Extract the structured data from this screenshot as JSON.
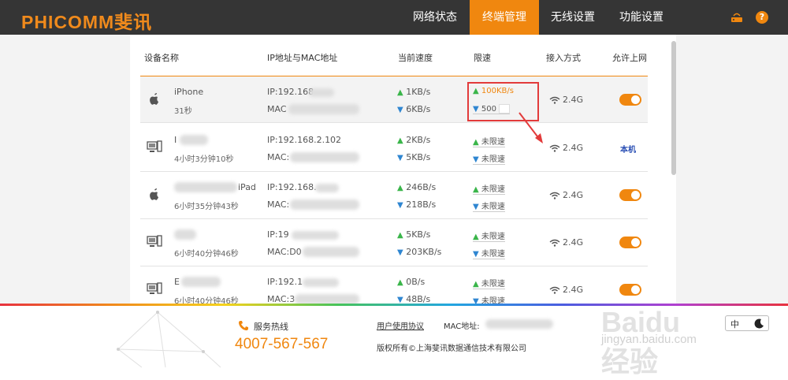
{
  "brand": {
    "logo": "PHICOMM斐讯"
  },
  "nav": [
    {
      "label": "网络状态",
      "active": false
    },
    {
      "label": "终端管理",
      "active": true
    },
    {
      "label": "无线设置",
      "active": false
    },
    {
      "label": "功能设置",
      "active": false
    }
  ],
  "help_label": "?",
  "table": {
    "headers": [
      "设备名称",
      "IP地址与MAC地址",
      "当前速度",
      "限速",
      "接入方式",
      "允许上网"
    ],
    "rows": [
      {
        "icon": "apple-icon",
        "name": "iPhone",
        "time": "31秒",
        "ip": "IP:192.168",
        "mac": "MAC",
        "up": "1KB/s",
        "down": "6KB/s",
        "limit_up": "100KB/s",
        "limit_down": "500",
        "access": "2.4G",
        "allow": "toggle-on"
      },
      {
        "icon": "pc-icon",
        "name": "I",
        "time": "4小时3分钟10秒",
        "ip": "IP:192.168.2.102",
        "mac": "MAC:",
        "up": "2KB/s",
        "down": "5KB/s",
        "limit_up": "未限速",
        "limit_down": "未限速",
        "access": "2.4G",
        "allow": "本机"
      },
      {
        "icon": "apple-icon",
        "name": "iPad",
        "time": "6小时35分钟43秒",
        "ip": "IP:192.168.",
        "mac": "MAC:",
        "up": "246B/s",
        "down": "218B/s",
        "limit_up": "未限速",
        "limit_down": "未限速",
        "access": "2.4G",
        "allow": "toggle-on"
      },
      {
        "icon": "pc-icon",
        "name": "",
        "time": "6小时40分钟46秒",
        "ip": "IP:19",
        "mac": "MAC:D0",
        "up": "5KB/s",
        "down": "203KB/s",
        "limit_up": "未限速",
        "limit_down": "未限速",
        "access": "2.4G",
        "allow": "toggle-on"
      },
      {
        "icon": "pc-icon",
        "name": "E",
        "time": "6小时40分钟46秒",
        "ip": "IP:192.1",
        "mac": "MAC:3",
        "up": "0B/s",
        "down": "48B/s",
        "limit_up": "未限速",
        "limit_down": "未限速",
        "access": "2.4G",
        "allow": "toggle-on"
      }
    ]
  },
  "footer": {
    "hotline_label": "服务热线",
    "hotline": "4007-567-567",
    "agreement": "用户使用协议",
    "mac_label": "MAC地址:",
    "copyright": "版权所有©上海斐讯数据通信技术有限公司"
  },
  "watermark": {
    "main": "Baidu经验",
    "sub": "jingyan.baidu.com"
  },
  "language": "中",
  "colors": {
    "accent": "#f0870f",
    "topbar": "#353535",
    "highlight_box": "#e23b3b",
    "up_arrow": "#3ab54a",
    "down_arrow": "#2f86d1"
  }
}
